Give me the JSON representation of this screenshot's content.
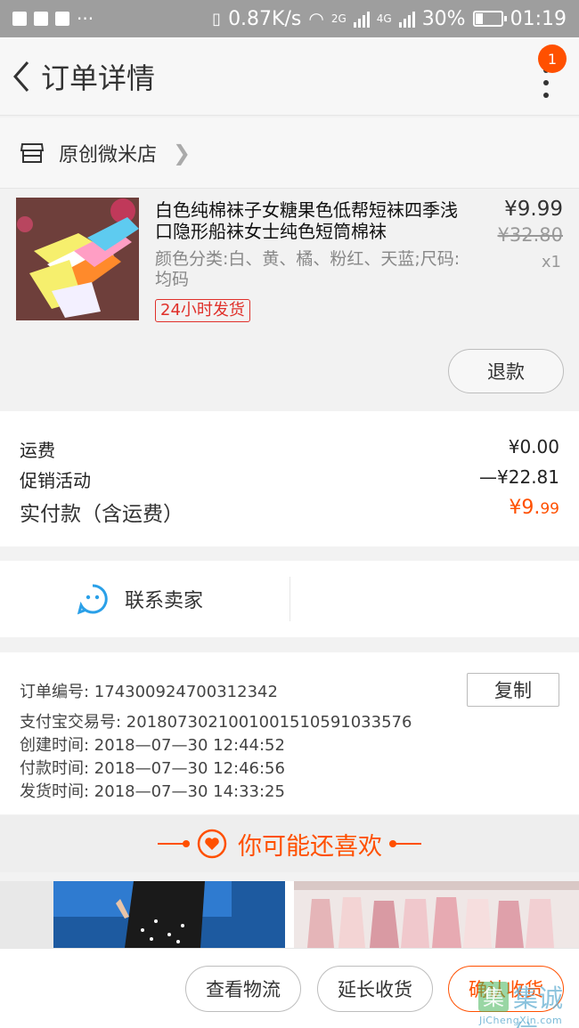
{
  "status_bar": {
    "network_speed": "0.87K/s",
    "battery": "30%",
    "time": "01:19",
    "sim1": "2G",
    "sim2": "4G",
    "battery_level": 0.3
  },
  "header": {
    "title": "订单详情",
    "badge_count": "1"
  },
  "shop": {
    "name": "原创微米店"
  },
  "item": {
    "title": "白色纯棉袜子女糖果色低帮短袜四季浅口隐形船袜女士纯色短筒棉袜",
    "sku": "颜色分类:白、黄、橘、粉红、天蓝;尺码:均码",
    "tag": "24小时发货",
    "price": "¥9.99",
    "original_price": "¥32.80",
    "quantity": "x1",
    "refund_label": "退款"
  },
  "summary": {
    "shipping_label": "运费",
    "shipping_value": "¥0.00",
    "promo_label": "促销活动",
    "promo_value": "—¥22.81",
    "total_label": "实付款（含运费）",
    "total_main": "¥9.",
    "total_cents": "99"
  },
  "contact": {
    "label": "联系卖家"
  },
  "order_info": {
    "order_no": "订单编号:  174300924700312342",
    "alipay_no": "支付宝交易号:  2018073021001001510591033576",
    "created": "创建时间:  2018—07—30  12:44:52",
    "paid": "付款时间:  2018—07—30  12:46:56",
    "shipped": "发货时间:  2018—07—30  14:33:25",
    "copy_label": "复制"
  },
  "recommend": {
    "title": "你可能还喜欢"
  },
  "bottom": {
    "logistics": "查看物流",
    "extend": "延长收货",
    "confirm": "确认收货"
  },
  "watermark": {
    "text": "集诚信",
    "sub": "JiChengXin.com"
  },
  "colors": {
    "accent": "#ff5000",
    "tag_red": "#e0302a",
    "status_bar": "#9e9e9e",
    "contact_blue": "#2aa0e8"
  }
}
